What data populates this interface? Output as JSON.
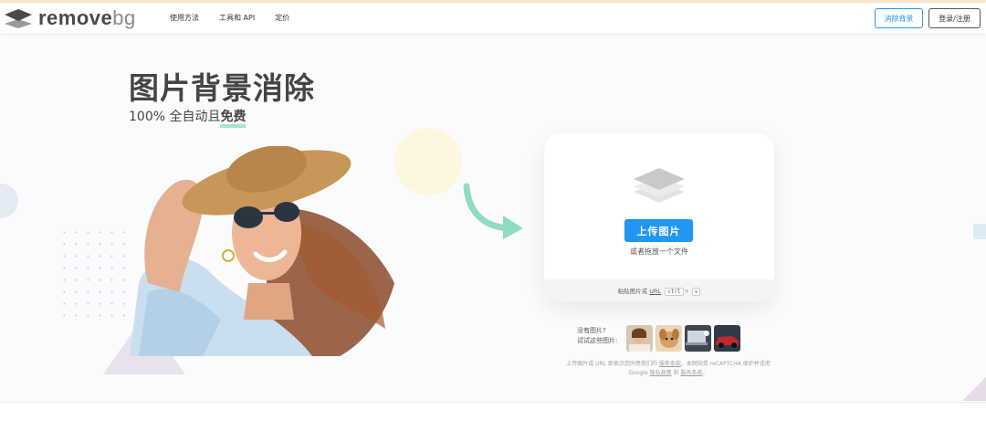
{
  "header": {
    "logo_text_main": "remove",
    "logo_text_suffix": "bg",
    "nav": [
      "使用方法",
      "工具和 API",
      "定价"
    ],
    "remove_bg_button": "消除背景",
    "login_button": "登录/注册"
  },
  "hero": {
    "title": "图片背景消除",
    "subtitle_prefix": "100% 全自动且",
    "subtitle_free": "免费"
  },
  "upload": {
    "button": "上传图片",
    "drop_text": "或者拖放一个文件",
    "paste_prefix": "粘贴图片或",
    "paste_url": "URL",
    "kbd_ctrl": "ctrl",
    "kbd_plus": "+",
    "kbd_v": "v"
  },
  "samples": {
    "label_line1": "没有图片?",
    "label_line2": "试试这些图片:",
    "thumbnails": [
      "woman-thumb",
      "dog-thumb",
      "laptop-thumb",
      "car-thumb"
    ]
  },
  "legal": {
    "line1_a": "上传图片或 URL 即表示您同意我们的",
    "line1_link": "服务条款",
    "line1_b": "。本网站受 reCAPTCHA 保护并适用",
    "line2_a": "Google",
    "line2_link1": "隐私政策",
    "line2_and": "和",
    "line2_link2": "服务条款",
    "line2_end": "。"
  },
  "colors": {
    "accent": "#2196f3",
    "free_underline": "#a7e3d2",
    "arrow": "#8fdcc1",
    "text_dark": "#454545"
  }
}
